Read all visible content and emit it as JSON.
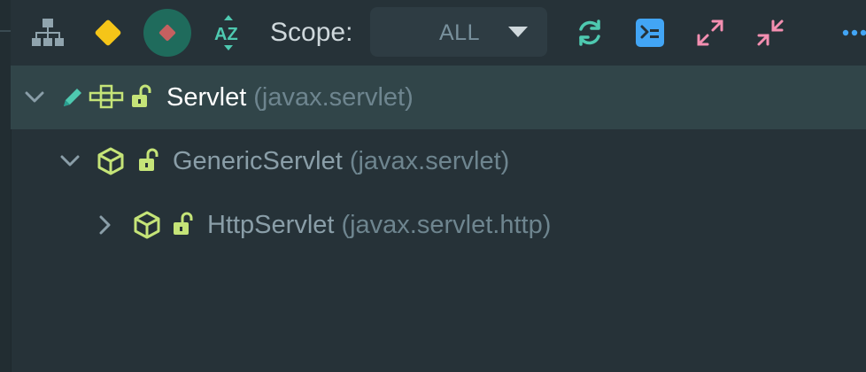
{
  "toolbar": {
    "scope_label": "Scope:",
    "scope_value": "ALL",
    "icons": [
      "hierarchy-icon",
      "diamond-icon",
      "record-icon",
      "sort-az-icon",
      "refresh-icon",
      "terminal-icon",
      "expand-icon",
      "collapse-icon",
      "more-icon"
    ],
    "colors": {
      "diamond": "#f5c518",
      "record_bg": "#1f6b5c",
      "record_fg": "#c46060",
      "teal": "#4ec9b0",
      "terminal": "#42a5f5",
      "pink": "#f48fb1"
    }
  },
  "tree": {
    "rows": [
      {
        "name": "Servlet",
        "package": "(javax.servlet)",
        "expanded": true,
        "selected": true,
        "kind": "interface"
      },
      {
        "name": "GenericServlet",
        "package": "(javax.servlet)",
        "expanded": true,
        "selected": false,
        "kind": "abstract-class"
      },
      {
        "name": "HttpServlet",
        "package": "(javax.servlet.http)",
        "expanded": false,
        "selected": false,
        "kind": "abstract-class"
      }
    ]
  },
  "colors": {
    "background": "#263238",
    "selected_row": "#314549",
    "icon_green": "#c5e478"
  }
}
